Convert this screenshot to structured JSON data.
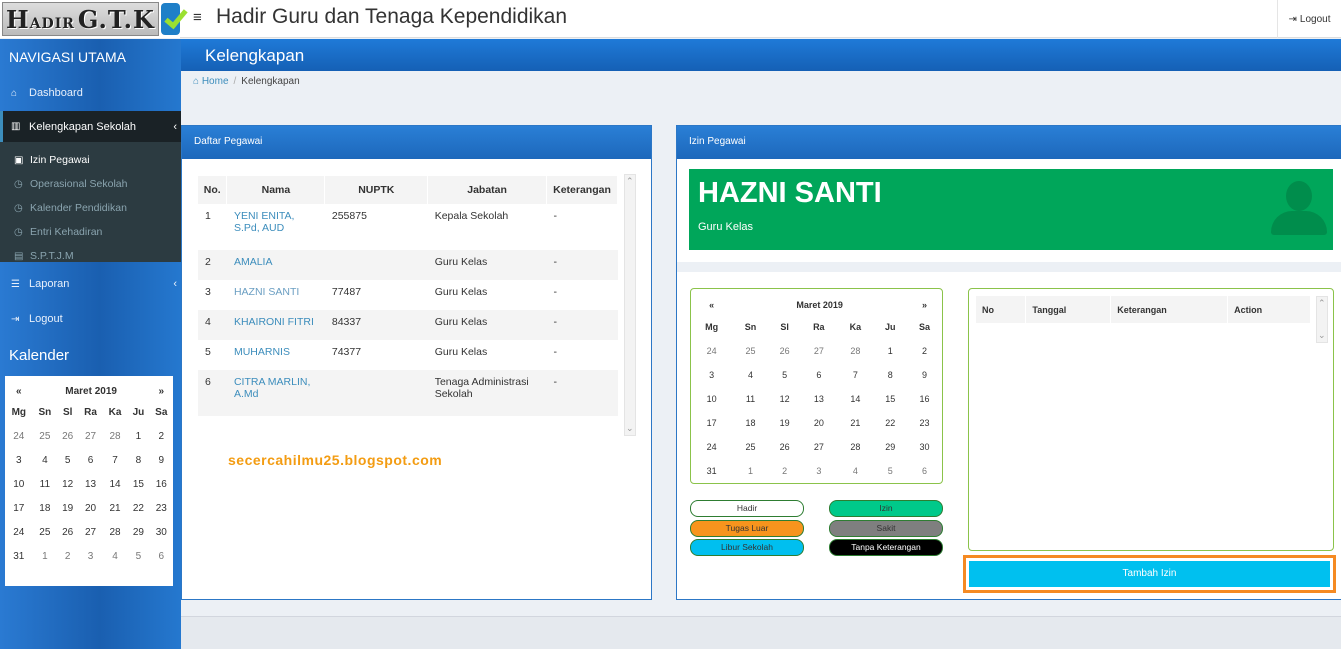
{
  "header": {
    "logo_text_big1": "H",
    "logo_text_small1": "ADIR",
    "logo_text_big2": "G.T.K",
    "title": "Hadir Guru dan Tenaga Kependidikan",
    "logout": "Logout"
  },
  "sidebar": {
    "nav_title": "NAVIGASI UTAMA",
    "items": {
      "dashboard": "Dashboard",
      "kelengkapan": "Kelengkapan Sekolah",
      "laporan": "Laporan",
      "logout": "Logout"
    },
    "submenu": {
      "izin": "Izin Pegawai",
      "operasional": "Operasional Sekolah",
      "kalender": "Kalender Pendidikan",
      "entri": "Entri Kehadiran",
      "sptjm": "S.P.T.J.M"
    },
    "calendar_title": "Kalender",
    "calendar": {
      "prev": "«",
      "month": "Maret 2019",
      "next": "»",
      "days": [
        "Mg",
        "Sn",
        "Sl",
        "Ra",
        "Ka",
        "Ju",
        "Sa"
      ],
      "weeks": [
        [
          "24",
          "25",
          "26",
          "27",
          "28",
          "1",
          "2"
        ],
        [
          "3",
          "4",
          "5",
          "6",
          "7",
          "8",
          "9"
        ],
        [
          "10",
          "11",
          "12",
          "13",
          "14",
          "15",
          "16"
        ],
        [
          "17",
          "18",
          "19",
          "20",
          "21",
          "22",
          "23"
        ],
        [
          "24",
          "25",
          "26",
          "27",
          "28",
          "29",
          "30"
        ],
        [
          "31",
          "1",
          "2",
          "3",
          "4",
          "5",
          "6"
        ]
      ]
    }
  },
  "page": {
    "title": "Kelengkapan",
    "breadcrumb_home": "Home",
    "breadcrumb_sep": "/",
    "breadcrumb_current": "Kelengkapan"
  },
  "daftar": {
    "title": "Daftar Pegawai",
    "columns": [
      "No.",
      "Nama",
      "NUPTK",
      "Jabatan",
      "Keterangan"
    ],
    "rows": [
      {
        "no": "1",
        "nama": "YENI ENITA, S.Pd, AUD",
        "nuptk": "255875",
        "jabatan": "Kepala Sekolah",
        "ket": "-"
      },
      {
        "no": "2",
        "nama": "AMALIA",
        "nuptk": "",
        "jabatan": "Guru Kelas",
        "ket": "-"
      },
      {
        "no": "3",
        "nama": "HAZNI SANTI",
        "nuptk": "77487",
        "jabatan": "Guru Kelas",
        "ket": "-"
      },
      {
        "no": "4",
        "nama": "KHAIRONI FITRI",
        "nuptk": "84337",
        "jabatan": "Guru Kelas",
        "ket": "-"
      },
      {
        "no": "5",
        "nama": "MUHARNIS",
        "nuptk": "74377",
        "jabatan": "Guru Kelas",
        "ket": "-"
      },
      {
        "no": "6",
        "nama": "CITRA MARLIN, A.Md",
        "nuptk": "",
        "jabatan": "Tenaga Administrasi Sekolah",
        "ket": "-"
      }
    ],
    "watermark": "secercahilmu25.blogspot.com"
  },
  "izin": {
    "title": "Izin Pegawai",
    "employee_name": "HAZNI SANTI",
    "employee_role": "Guru Kelas",
    "calendar": {
      "prev": "«",
      "month": "Maret 2019",
      "next": "»",
      "days": [
        "Mg",
        "Sn",
        "Sl",
        "Ra",
        "Ka",
        "Ju",
        "Sa"
      ],
      "weeks": [
        [
          "24",
          "25",
          "26",
          "27",
          "28",
          "1",
          "2"
        ],
        [
          "3",
          "4",
          "5",
          "6",
          "7",
          "8",
          "9"
        ],
        [
          "10",
          "11",
          "12",
          "13",
          "14",
          "15",
          "16"
        ],
        [
          "17",
          "18",
          "19",
          "20",
          "21",
          "22",
          "23"
        ],
        [
          "24",
          "25",
          "26",
          "27",
          "28",
          "29",
          "30"
        ],
        [
          "31",
          "1",
          "2",
          "3",
          "4",
          "5",
          "6"
        ]
      ]
    },
    "legend": {
      "hadir": "Hadir",
      "izin": "Izin",
      "tugas_luar": "Tugas Luar",
      "sakit": "Sakit",
      "libur": "Libur Sekolah",
      "tanpa": "Tanpa Keterangan"
    },
    "table_columns": [
      "No",
      "Tanggal",
      "Keterangan",
      "Action"
    ],
    "add_button": "Tambah Izin"
  },
  "colors": {
    "header_blue": "#1d68bb",
    "info_green": "#00a65a",
    "add_button": "#00c0ef",
    "highlight_orange": "#f58a22",
    "legend_izin": "#00c98a",
    "legend_tugas": "#f7941d",
    "legend_sakit": "#7f7f7f",
    "legend_libur": "#00bfef",
    "legend_tanpa": "#000000"
  }
}
